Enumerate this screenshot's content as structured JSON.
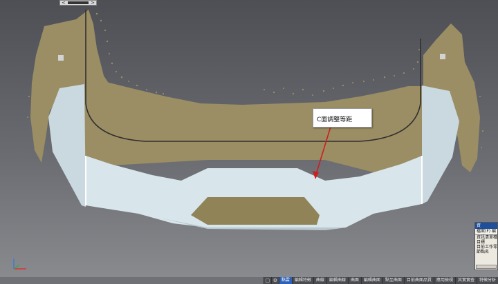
{
  "viewport": {
    "callout_text": "C面調整等距",
    "colors": {
      "scan_surface": "#9b8e64",
      "bumper_surface": "#d8e6ec",
      "arrow": "#cc1f1f"
    }
  },
  "top_slider": {
    "left_arrow": "<",
    "right_arrow": ">"
  },
  "side_panel": {
    "title": "資",
    "menu": "檔案(F)  編",
    "rows": [
      "資訊清單種",
      "目標",
      "目前工作零",
      "節點名"
    ]
  },
  "status_bar": {
    "icons": [
      "box-icon",
      "gear-icon"
    ],
    "buttons": [
      "點雲",
      "編輯特徵",
      "曲線",
      "編輯曲線",
      "曲面",
      "編輯曲面",
      "點至曲面",
      "目前曲面品質",
      "應用檢視",
      "其實實查",
      "特徵分析"
    ],
    "active_index": 0
  }
}
